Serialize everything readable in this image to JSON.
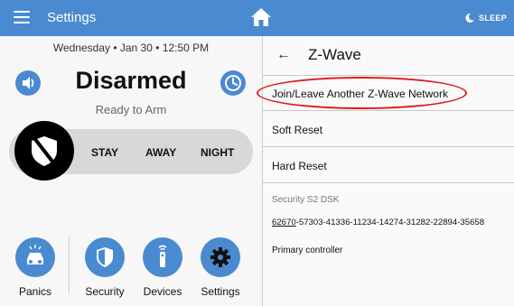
{
  "topbar": {
    "title": "Settings",
    "sleep_label": "SLEEP",
    "color": "#4a8ad0"
  },
  "left": {
    "datetime": "Wednesday • Jan 30 • 12:50 PM",
    "status": "Disarmed",
    "substatus": "Ready to Arm",
    "arm_options": [
      "STAY",
      "AWAY",
      "NIGHT"
    ],
    "tray": [
      {
        "label": "Panics",
        "icon": "panic-car-icon"
      },
      {
        "label": "Security",
        "icon": "shield-check-icon"
      },
      {
        "label": "Devices",
        "icon": "remote-control-icon"
      },
      {
        "label": "Settings",
        "icon": "gear-icon"
      }
    ]
  },
  "right": {
    "title": "Z-Wave",
    "rows": [
      {
        "label": "Join/Leave Another Z-Wave Network"
      },
      {
        "label": "Soft Reset"
      },
      {
        "label": "Hard Reset"
      }
    ],
    "dsk_label": "Security S2 DSK",
    "dsk_prefix": "62670",
    "dsk_rest": "-57303-41336-11234-14274-31282-22894-35658",
    "role": "Primary controller",
    "highlight_color": "#e21b1b"
  }
}
